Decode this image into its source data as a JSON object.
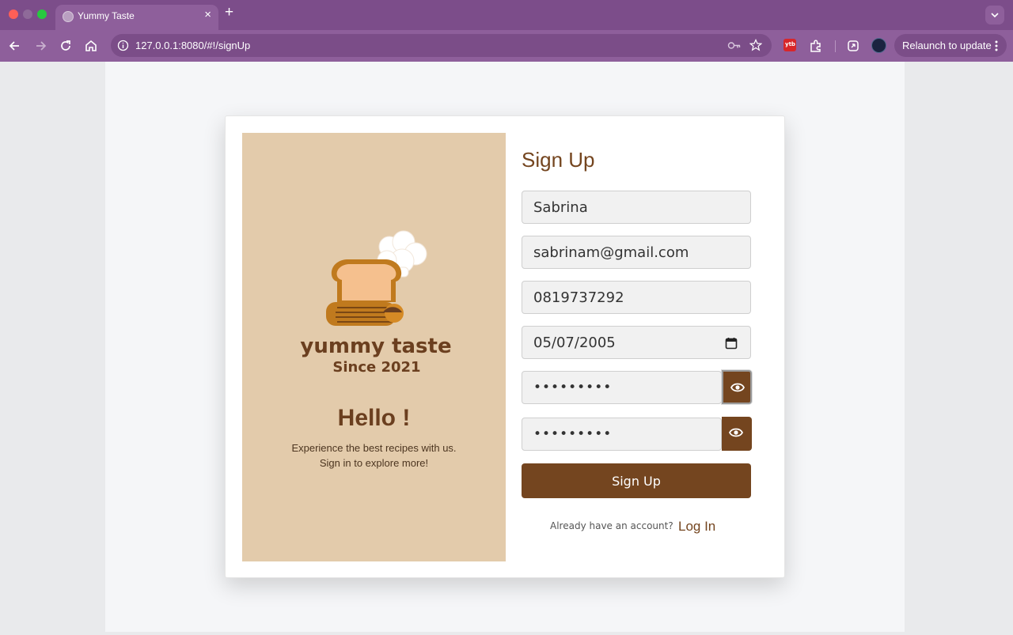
{
  "browser": {
    "tab_title": "Yummy Taste",
    "tab_close": "×",
    "new_tab": "+",
    "url": "127.0.0.1:8080/#!/signUp",
    "relaunch_label": "Relaunch to update",
    "accent_color": "#7c4d8a"
  },
  "brand": {
    "primary_color": "#74451f",
    "panel_color": "#e3cbab",
    "logo_name": "yummy taste",
    "logo_tagline": "Since 2021"
  },
  "panel": {
    "greeting": "Hello !",
    "line1": "Experience the best recipes with us.",
    "line2": "Sign in to explore more!"
  },
  "form": {
    "heading": "Sign Up",
    "name_value": "Sabrina",
    "email_value": "sabrinam@gmail.com",
    "phone_value": "0819737292",
    "dob_value": "05/07/2005",
    "password_value": "•••••••••",
    "confirm_value": "•••••••••",
    "submit_label": "Sign Up",
    "account_prompt": "Already have an account?",
    "login_link": "Log In"
  },
  "icons": [
    "globe-icon",
    "close-icon",
    "plus-icon",
    "chevron-down-icon",
    "back-icon",
    "forward-icon",
    "reload-icon",
    "home-icon",
    "info-icon",
    "key-icon",
    "star-icon",
    "extension-icon",
    "puzzle-icon",
    "sync-icon",
    "avatar",
    "more-vert-icon",
    "calendar-icon",
    "eye-icon"
  ]
}
